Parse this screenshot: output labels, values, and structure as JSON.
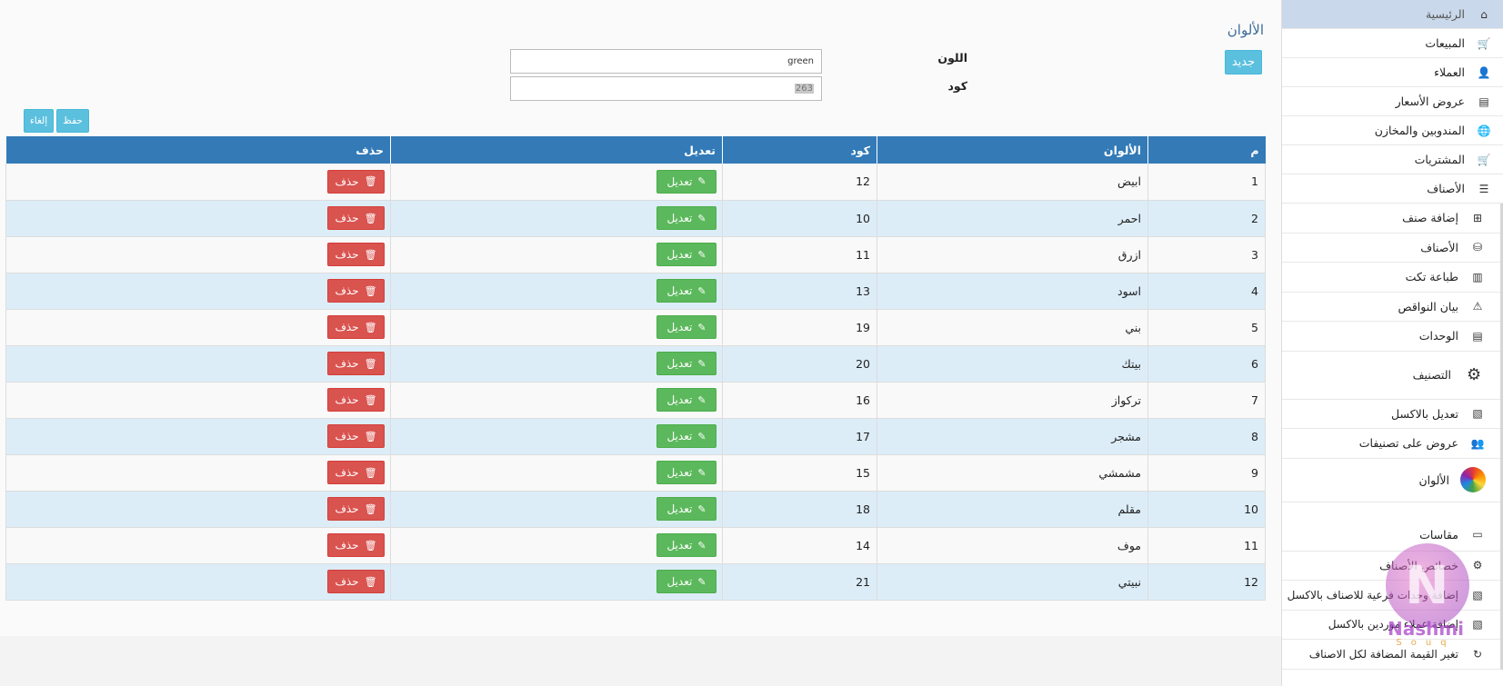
{
  "sidebar": {
    "items": [
      {
        "label": "الرئيسية",
        "icon": "home-icon",
        "glyph": "⌂"
      },
      {
        "label": "المبيعات",
        "icon": "cart-icon",
        "glyph": "🛒"
      },
      {
        "label": "العملاء",
        "icon": "user-icon",
        "glyph": "👤"
      },
      {
        "label": "عروض الأسعار",
        "icon": "list-alt-icon",
        "glyph": "▤"
      },
      {
        "label": "المندوبين والمخازن",
        "icon": "globe-icon",
        "glyph": "🌐"
      },
      {
        "label": "المشتريات",
        "icon": "cart-download-icon",
        "glyph": "🛒"
      },
      {
        "label": "الأصناف",
        "icon": "list-icon",
        "glyph": "☰"
      }
    ],
    "subitems": [
      {
        "label": "إضافة صنف",
        "icon": "plus-square-icon",
        "glyph": "⊞"
      },
      {
        "label": "الأصناف",
        "icon": "database-icon",
        "glyph": "⛁"
      },
      {
        "label": "طباعة تكت",
        "icon": "barcode-icon",
        "glyph": "▥"
      },
      {
        "label": "بيان النواقص",
        "icon": "warning-icon",
        "glyph": "⚠"
      },
      {
        "label": "الوحدات",
        "icon": "tasks-icon",
        "glyph": "▤"
      },
      {
        "label": "التصنيف",
        "icon": "hierarchy-settings-icon",
        "glyph": "⚙"
      },
      {
        "label": "تعديل بالاكسل",
        "icon": "excel-file-icon",
        "glyph": "▧"
      },
      {
        "label": "عروض على تصنيفات",
        "icon": "users-icon",
        "glyph": "👥"
      },
      {
        "label": "الألوان",
        "icon": "color-wheel-icon",
        "glyph": "●"
      },
      {
        "label": "مقاسات",
        "icon": "ruler-icon",
        "glyph": "▭"
      },
      {
        "label": "خصائص الأصناف",
        "icon": "gear-icon",
        "glyph": "⚙"
      },
      {
        "label": "إضافة وحدات فرعية للاصناف بالاكسل",
        "icon": "excel-file-icon",
        "glyph": "▧"
      },
      {
        "label": "إضافة عملاء موردين بالاكسل",
        "icon": "excel-file-icon",
        "glyph": "▧"
      },
      {
        "label": "تغير القيمة المضافة لكل الاصناف",
        "icon": "refresh-icon",
        "glyph": "↻"
      }
    ]
  },
  "page": {
    "title": "الألوان",
    "new_label": "جديد",
    "form": {
      "color_label": "اللون",
      "color_value": "green",
      "code_label": "كود",
      "code_value": "263"
    },
    "save_label": "حفظ",
    "cancel_label": "إلغاء"
  },
  "table": {
    "headers": [
      "م",
      "الألوان",
      "كود",
      "تعديل",
      "حذف"
    ],
    "edit_label": "تعديل",
    "delete_label": "حذف",
    "rows": [
      {
        "n": "1",
        "name": "ابيض",
        "code": "12"
      },
      {
        "n": "2",
        "name": "احمر",
        "code": "10"
      },
      {
        "n": "3",
        "name": "ازرق",
        "code": "11"
      },
      {
        "n": "4",
        "name": "اسود",
        "code": "13"
      },
      {
        "n": "5",
        "name": "بني",
        "code": "19"
      },
      {
        "n": "6",
        "name": "بيتك",
        "code": "20"
      },
      {
        "n": "7",
        "name": "تركواز",
        "code": "16"
      },
      {
        "n": "8",
        "name": "مشجر",
        "code": "17"
      },
      {
        "n": "9",
        "name": "مشمشي",
        "code": "15"
      },
      {
        "n": "10",
        "name": "مقلم",
        "code": "18"
      },
      {
        "n": "11",
        "name": "موف",
        "code": "14"
      },
      {
        "n": "12",
        "name": "نبيتي",
        "code": "21"
      }
    ]
  },
  "watermark": {
    "brand": "Nashmi",
    "sub": "Souq"
  },
  "colors": {
    "header_blue": "#337ab7",
    "info": "#5bc0de",
    "success": "#5cb85c",
    "danger": "#d9534f",
    "row_alt": "#dcedf8"
  }
}
